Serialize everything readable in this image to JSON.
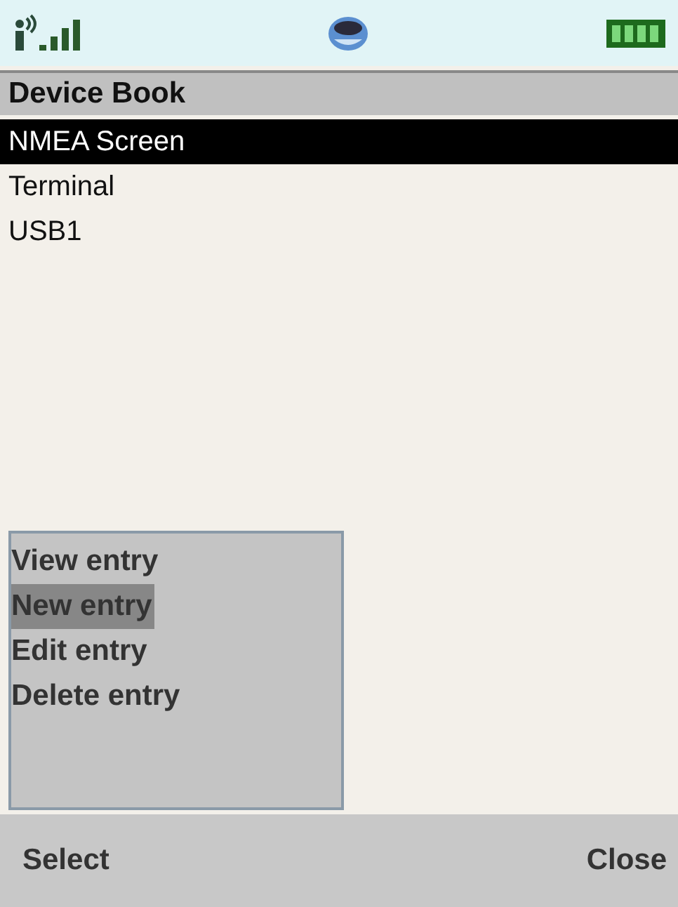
{
  "title": "Device Book",
  "items": [
    {
      "label": "NMEA Screen",
      "selected": true
    },
    {
      "label": "Terminal",
      "selected": false
    },
    {
      "label": "USB1",
      "selected": false
    }
  ],
  "menu": [
    {
      "label": "View entry",
      "selected": false
    },
    {
      "label": "New entry",
      "selected": true
    },
    {
      "label": "Edit entry",
      "selected": false
    },
    {
      "label": "Delete entry",
      "selected": false
    }
  ],
  "softkeys": {
    "left": "Select",
    "right": "Close"
  }
}
